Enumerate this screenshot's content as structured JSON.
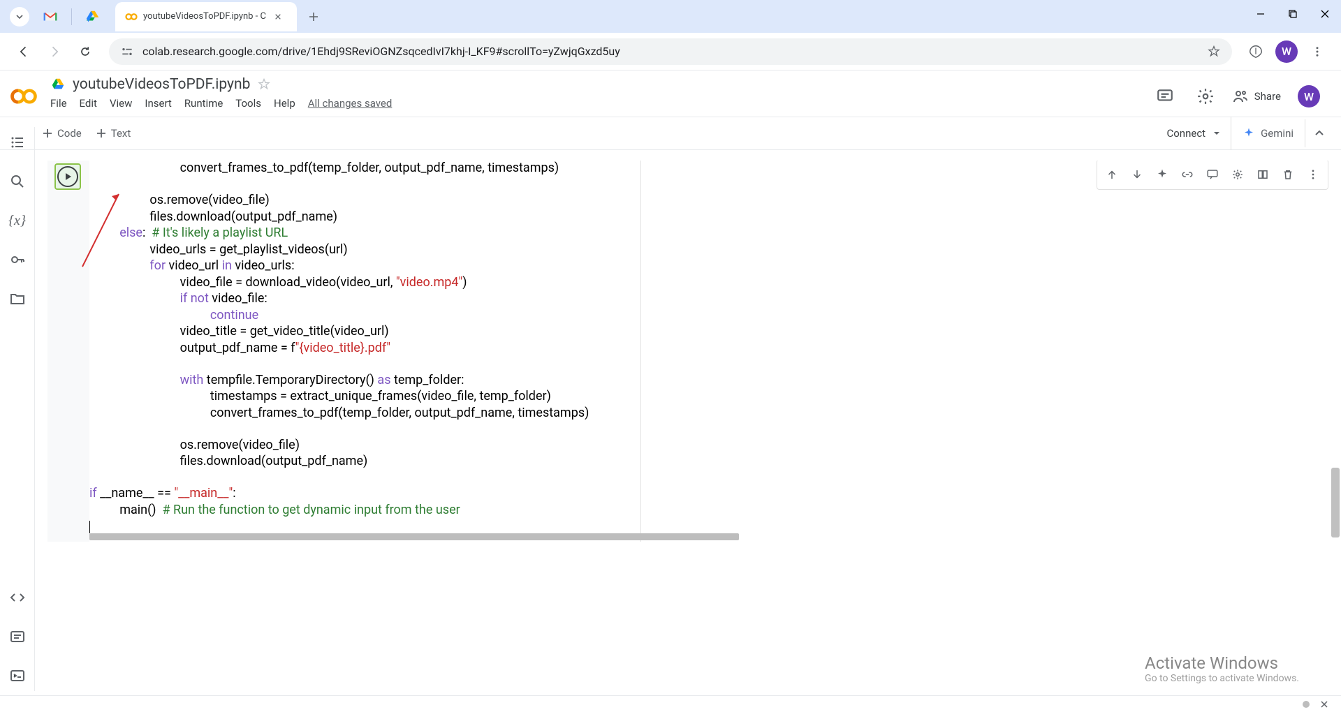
{
  "browser": {
    "tab_title": "youtubeVideosToPDF.ipynb - C",
    "url": "colab.research.google.com/drive/1Ehdj9SReviOGNZsqcedIvI7khj-I_KF9#scrollTo=yZwjqGxzd5uy",
    "profile_initial": "W"
  },
  "colab": {
    "filename": "youtubeVideosToPDF.ipynb",
    "menu": {
      "file": "File",
      "edit": "Edit",
      "view": "View",
      "insert": "Insert",
      "runtime": "Runtime",
      "tools": "Tools",
      "help": "Help",
      "status": "All changes saved"
    },
    "share_label": "Share",
    "header_profile_initial": "W",
    "toolbar": {
      "code": "Code",
      "text": "Text",
      "connect": "Connect",
      "gemini": "Gemini"
    }
  },
  "code_lines": [
    {
      "indent": 12,
      "seg": [
        {
          "t": "convert_frames_to_pdf(temp_folder, output_pdf_name, timestamps)"
        }
      ]
    },
    {
      "indent": 0,
      "seg": []
    },
    {
      "indent": 8,
      "seg": [
        {
          "t": "os.remove(video_file)"
        }
      ]
    },
    {
      "indent": 8,
      "seg": [
        {
          "t": "files.download(output_pdf_name)"
        }
      ]
    },
    {
      "indent": 4,
      "seg": [
        {
          "t": "else",
          "c": "kw2"
        },
        {
          "t": ":  "
        },
        {
          "t": "# It's likely a playlist URL",
          "c": "cmt"
        }
      ]
    },
    {
      "indent": 8,
      "seg": [
        {
          "t": "video_urls = get_playlist_videos(url)"
        }
      ]
    },
    {
      "indent": 8,
      "seg": [
        {
          "t": "for",
          "c": "kw2"
        },
        {
          "t": " video_url "
        },
        {
          "t": "in",
          "c": "kw2"
        },
        {
          "t": " video_urls:"
        }
      ]
    },
    {
      "indent": 12,
      "seg": [
        {
          "t": "video_file = download_video(video_url, "
        },
        {
          "t": "\"video.mp4\"",
          "c": "str"
        },
        {
          "t": ")"
        }
      ]
    },
    {
      "indent": 12,
      "seg": [
        {
          "t": "if",
          "c": "kw2"
        },
        {
          "t": " "
        },
        {
          "t": "not",
          "c": "kw2"
        },
        {
          "t": " video_file:"
        }
      ]
    },
    {
      "indent": 16,
      "seg": [
        {
          "t": "continue",
          "c": "kw2"
        }
      ]
    },
    {
      "indent": 12,
      "seg": [
        {
          "t": "video_title = get_video_title(video_url)"
        }
      ]
    },
    {
      "indent": 12,
      "seg": [
        {
          "t": "output_pdf_name = f"
        },
        {
          "t": "\"{video_title}.pdf\"",
          "c": "str"
        }
      ]
    },
    {
      "indent": 0,
      "seg": []
    },
    {
      "indent": 12,
      "seg": [
        {
          "t": "with",
          "c": "kw2"
        },
        {
          "t": " tempfile.TemporaryDirectory() "
        },
        {
          "t": "as",
          "c": "kw2"
        },
        {
          "t": " temp_folder:"
        }
      ]
    },
    {
      "indent": 16,
      "seg": [
        {
          "t": "timestamps = extract_unique_frames(video_file, temp_folder)"
        }
      ]
    },
    {
      "indent": 16,
      "seg": [
        {
          "t": "convert_frames_to_pdf(temp_folder, output_pdf_name, timestamps)"
        }
      ]
    },
    {
      "indent": 0,
      "seg": []
    },
    {
      "indent": 12,
      "seg": [
        {
          "t": "os.remove(video_file)"
        }
      ]
    },
    {
      "indent": 12,
      "seg": [
        {
          "t": "files.download(output_pdf_name)"
        }
      ]
    },
    {
      "indent": 0,
      "seg": []
    },
    {
      "indent": 0,
      "seg": [
        {
          "t": "if",
          "c": "kw2"
        },
        {
          "t": " __name__ == "
        },
        {
          "t": "\"__main__\"",
          "c": "str"
        },
        {
          "t": ":"
        }
      ]
    },
    {
      "indent": 4,
      "seg": [
        {
          "t": "main()  "
        },
        {
          "t": "# Run the function to get dynamic input from the user",
          "c": "cmt"
        }
      ]
    }
  ],
  "watermark": {
    "title": "Activate Windows",
    "sub": "Go to Settings to activate Windows."
  }
}
